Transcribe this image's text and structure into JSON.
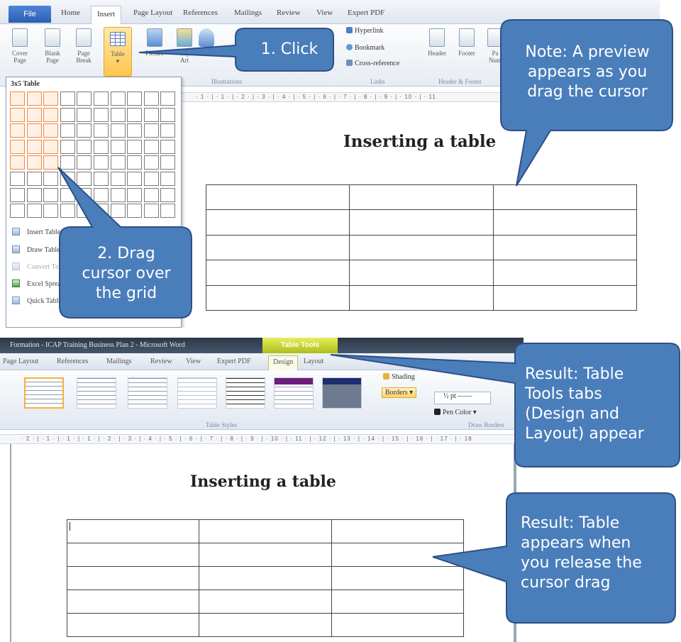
{
  "top": {
    "tabs": [
      "File",
      "Home",
      "Insert",
      "Page Layout",
      "References",
      "Mailings",
      "Review",
      "View",
      "Expert PDF"
    ],
    "ribbon_buttons": {
      "cover": [
        "Cover",
        "Page"
      ],
      "blank": [
        "Blank",
        "Page"
      ],
      "page_break": [
        "Page",
        "Break"
      ],
      "table": "Table",
      "picture": "Picture",
      "clip_art": [
        "Clip",
        "Art"
      ],
      "header": "Header",
      "footer": "Footer",
      "page_number": [
        "Pa",
        "Num"
      ]
    },
    "links": [
      "Hyperlink",
      "Bookmark",
      "Cross-reference"
    ],
    "group_labels": [
      "Illustrations",
      "Links",
      "Header & Footer"
    ],
    "ruler": "· 1 · | · 1 · | · 2 · | · 3 · | · 4 · | · 5 · | · 6 · | · 7 · | · 8 · | · 9 · | · 10 · | · 11",
    "picker": {
      "title": "3x5 Table",
      "menu": [
        "Insert Table...",
        "Draw Table",
        "Convert Text to Table...",
        "Excel Spreadsheet",
        "Quick Tables"
      ]
    },
    "doc_title": "Inserting a table"
  },
  "bottom": {
    "window_title": "Formation - ICAP Training Business Plan 2 - Microsoft Word",
    "table_tools": "Table Tools",
    "tabs": [
      "Page Layout",
      "References",
      "Mailings",
      "Review",
      "View",
      "Expert PDF",
      "Design",
      "Layout"
    ],
    "shading": "Shading",
    "borders": "Borders",
    "pen_weight": "½ pt",
    "pen_color": "Pen Color",
    "group_labels": [
      "Table Styles",
      "Draw Borders"
    ],
    "ruler": "· 2 · | · 1 · | · 1 · | · 1 · | · 2 · | · 3 · | · 4 · | · 5 · | · 6 · | · 7 · | · 8 · | · 9 · | · 10 · | · 11 · | · 12 · | · 13 · | · 14 · | · 15 · | · 16 · | · 17 · | · 18",
    "doc_title": "Inserting a table"
  },
  "callouts": {
    "click": "1. Click",
    "preview": [
      "Note: A preview",
      "appears as you",
      "drag the cursor"
    ],
    "drag": [
      "2. Drag",
      "cursor over",
      "the grid"
    ],
    "tools": [
      "Result: Table",
      "Tools tabs",
      "(Design and",
      "Layout) appear"
    ],
    "appears": [
      "Result: Table",
      "appears when",
      "you release the",
      "cursor drag"
    ]
  },
  "colors": {
    "callout_fill": "#4a7ebb",
    "callout_stroke": "#2e4f86",
    "picker_highlight": "#f0883e",
    "file_tab": "#2a5eb3",
    "table_tools": "#aebd1c"
  }
}
